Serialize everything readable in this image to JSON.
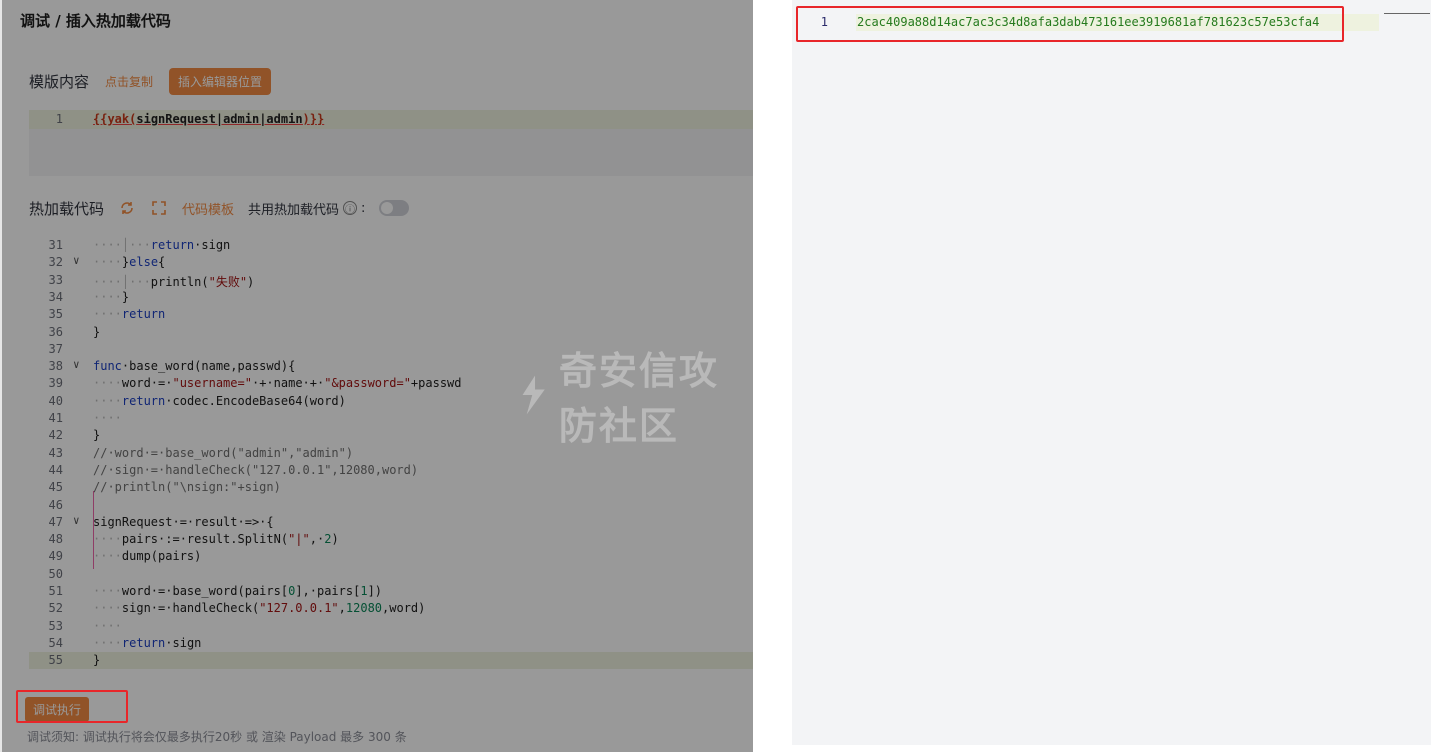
{
  "left": {
    "title": "调试 / 插入热加载代码",
    "template": {
      "label": "模版内容",
      "copy_link": "点击复制",
      "insert_button": "插入编辑器位置",
      "line_number": "1",
      "code_open": "{{",
      "code_fn": "yak",
      "code_paren_open": "(",
      "code_args": "signRequest|admin|admin",
      "code_paren_close": ")",
      "code_close": "}}"
    },
    "hotload": {
      "label": "热加载代码",
      "refresh_icon": "refresh-icon",
      "expand_icon": "expand-icon",
      "template_link": "代码模板",
      "shared_label": "共用热加载代码",
      "shared_colon": ":",
      "info_icon": "ⓘ"
    },
    "code_lines": [
      {
        "n": "31",
        "fold": ""
      },
      {
        "n": "32",
        "fold": "∨"
      },
      {
        "n": "33",
        "fold": ""
      },
      {
        "n": "34",
        "fold": ""
      },
      {
        "n": "35",
        "fold": ""
      },
      {
        "n": "36",
        "fold": ""
      },
      {
        "n": "37",
        "fold": ""
      },
      {
        "n": "38",
        "fold": "∨"
      },
      {
        "n": "39",
        "fold": ""
      },
      {
        "n": "40",
        "fold": ""
      },
      {
        "n": "41",
        "fold": ""
      },
      {
        "n": "42",
        "fold": ""
      },
      {
        "n": "43",
        "fold": ""
      },
      {
        "n": "44",
        "fold": ""
      },
      {
        "n": "45",
        "fold": ""
      },
      {
        "n": "46",
        "fold": ""
      },
      {
        "n": "47",
        "fold": "∨"
      },
      {
        "n": "48",
        "fold": ""
      },
      {
        "n": "49",
        "fold": ""
      },
      {
        "n": "50",
        "fold": ""
      },
      {
        "n": "51",
        "fold": ""
      },
      {
        "n": "52",
        "fold": ""
      },
      {
        "n": "53",
        "fold": ""
      },
      {
        "n": "54",
        "fold": ""
      },
      {
        "n": "55",
        "fold": ""
      }
    ],
    "code_text": {
      "l31_ws": "····│···",
      "l31_kw": "return",
      "l31_rest": "·sign",
      "l32_ws": "····",
      "l32_rest": "}",
      "l32_kw": "else",
      "l32_tail": "{",
      "l33_ws": "····│···",
      "l33_fn": "println(",
      "l33_str": "\"失败\"",
      "l33_tail": ")",
      "l34_ws": "····",
      "l34_rest": "}",
      "l35_ws": "····",
      "l35_kw": "return",
      "l36": "}",
      "l37": "",
      "l38_kw": "func",
      "l38_rest": "·base_word(name,passwd){",
      "l39_ws": "····",
      "l39_a": "word·=·",
      "l39_s1": "\"username=\"",
      "l39_b": "·+·name·+·",
      "l39_s2": "\"&password=\"",
      "l39_c": "+passwd",
      "l40_ws": "····",
      "l40_kw": "return",
      "l40_rest": "·codec.EncodeBase64(word)",
      "l41_ws": "····",
      "l42": "}",
      "l43": "//·word·=·base_word(\"admin\",\"admin\")",
      "l44": "//·sign·=·handleCheck(\"127.0.0.1\",12080,word)",
      "l45": "//·println(\"\\nsign:\"+sign)",
      "l46": "",
      "l47_a": "signRequest·=·result·=>·{",
      "l48_ws": "····",
      "l48_a": "pairs·:=·result.SplitN(",
      "l48_s": "\"|\"",
      "l48_b": ",·",
      "l48_n": "2",
      "l48_c": ")",
      "l49_ws": "····",
      "l49_a": "dump(pairs)",
      "l50": "",
      "l51_ws": "····",
      "l51_a": "word·=·base_word(pairs[",
      "l51_n1": "0",
      "l51_b": "],·pairs[",
      "l51_n2": "1",
      "l51_c": "])",
      "l52_ws": "····",
      "l52_a": "sign·=·handleCheck(",
      "l52_s": "\"127.0.0.1\"",
      "l52_b": ",",
      "l52_n": "12080",
      "l52_c": ",word)",
      "l53_ws": "····",
      "l54_ws": "····",
      "l54_kw": "return",
      "l54_rest": "·sign",
      "l55": "}"
    },
    "run_button": "调试执行",
    "note": "调试须知: 调试执行将会仅最多执行20秒 或 渲染 Payload 最多 300 条",
    "watermark": "奇安信攻防社区"
  },
  "right": {
    "line_number": "1",
    "result": "2cac409a88d14ac7ac3c34d8afa3dab473161ee3919681af781623c57e53cfa4"
  },
  "colors": {
    "accent": "#f28b44",
    "highlight_box": "#e8262a",
    "active_line": "#eef2df"
  }
}
